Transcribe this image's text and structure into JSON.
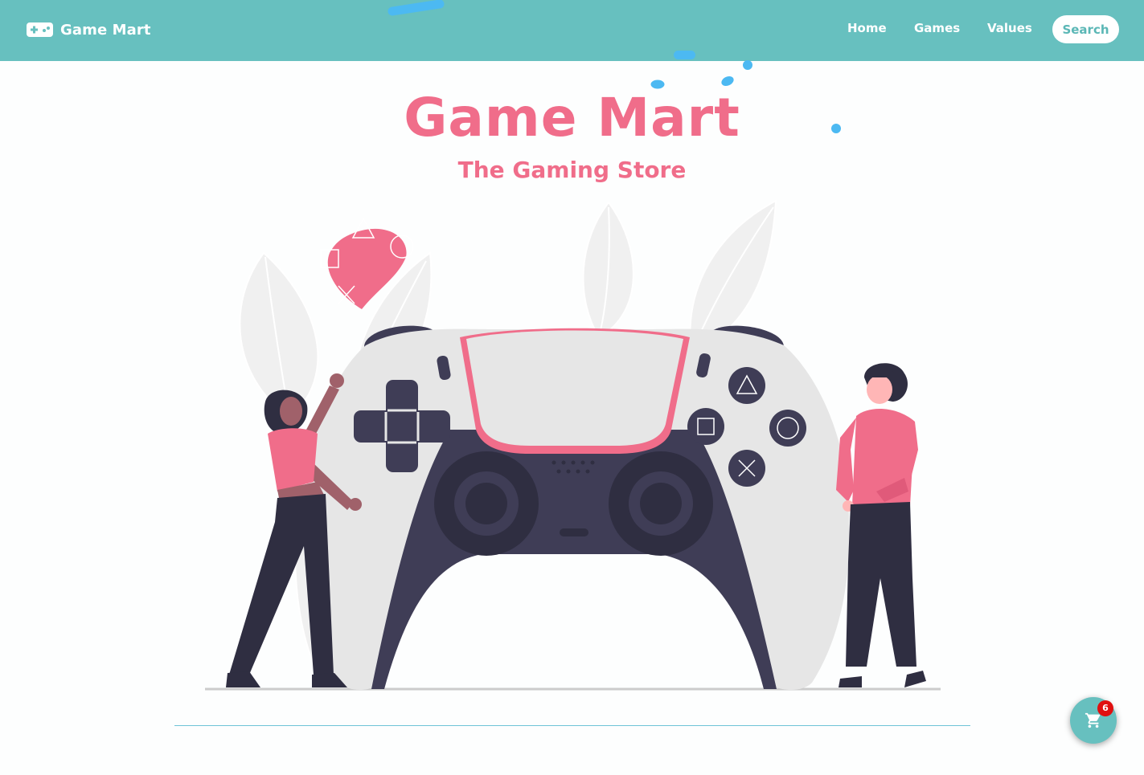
{
  "nav": {
    "brand": "Game Mart",
    "links": [
      "Home",
      "Games",
      "Values"
    ],
    "search_label": "Search"
  },
  "hero": {
    "title": "Game Mart",
    "subtitle": "The Gaming Store"
  },
  "cart": {
    "count": "6"
  },
  "colors": {
    "navbar": "#67c0bf",
    "accent_pink": "#f06d8a",
    "controller_dark": "#3f3d56",
    "controller_light": "#e6e6e6",
    "confetti_blue": "#4cb9f2",
    "badge_red": "#e00f0f"
  },
  "icons": {
    "brand": "gamepad-icon",
    "cart": "shopping-cart-icon"
  }
}
